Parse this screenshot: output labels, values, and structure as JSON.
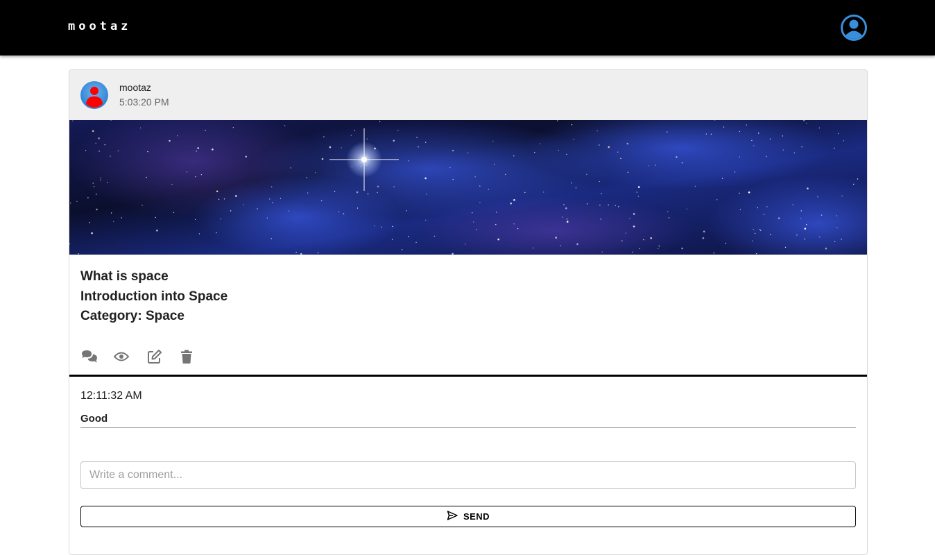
{
  "header": {
    "brand": "mootaz",
    "account_icon": "account-circle-icon"
  },
  "post": {
    "author": "mootaz",
    "time": "5:03:20 PM",
    "avatar_icon": "user-avatar-icon",
    "image_description_icon": "space-banner-image",
    "title": "What is space",
    "subtitle": "Introduction into Space",
    "category": "Category: Space",
    "actions": [
      {
        "icon": "comments-icon"
      },
      {
        "icon": "eye-icon"
      },
      {
        "icon": "edit-icon"
      },
      {
        "icon": "trash-icon"
      }
    ]
  },
  "comments": [
    {
      "time": "12:11:32 AM",
      "text": "Good"
    }
  ],
  "comment_form": {
    "placeholder": "Write a comment...",
    "value": "",
    "send_label": "SEND",
    "send_icon": "send-icon"
  },
  "colors": {
    "topbar": "#000000",
    "header_bg": "#efefef",
    "avatar_blue": "#2d8ee0",
    "avatar_red": "#ff0000"
  }
}
